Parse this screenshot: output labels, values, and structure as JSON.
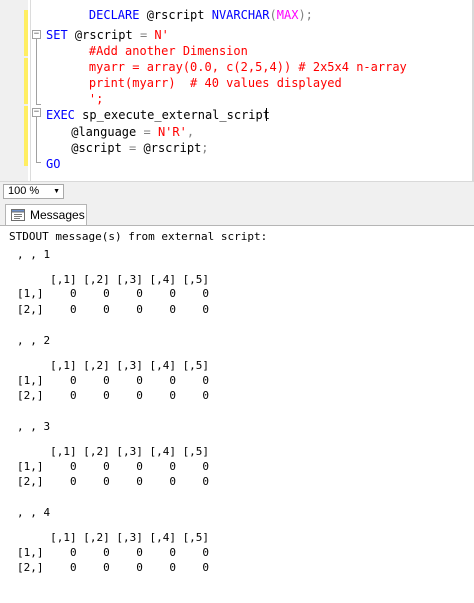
{
  "editor": {
    "lines": [
      [
        {
          "t": "    "
        },
        {
          "t": "DECLARE",
          "c": "kw"
        },
        {
          "t": " @rscript "
        },
        {
          "t": "NVARCHAR",
          "c": "kw"
        },
        {
          "t": "(",
          "c": "op"
        },
        {
          "t": "MAX",
          "c": "fn"
        },
        {
          "t": ");",
          "c": "op"
        }
      ],
      [
        {
          "t": "SET",
          "c": "kw"
        },
        {
          "t": " @rscript "
        },
        {
          "t": "=",
          "c": "op"
        },
        {
          "t": " "
        },
        {
          "t": "N'",
          "c": "str"
        }
      ],
      [
        {
          "t": "    #Add another Dimension",
          "c": "str"
        }
      ],
      [
        {
          "t": "    myarr = array(0.0, c(2,5,4)) # 2x5x4 n-array",
          "c": "str"
        }
      ],
      [
        {
          "t": "    print(myarr)  # 40 values displayed",
          "c": "str"
        }
      ],
      [
        {
          "t": "    ';",
          "c": "str"
        }
      ],
      [
        {
          "t": "EXEC",
          "c": "kw"
        },
        {
          "t": " sp_execute_external_script"
        }
      ],
      [
        {
          "t": " @language "
        },
        {
          "t": "=",
          "c": "op"
        },
        {
          "t": " "
        },
        {
          "t": "N'R'",
          "c": "str"
        },
        {
          "t": ",",
          "c": "op"
        }
      ],
      [
        {
          "t": " @script "
        },
        {
          "t": "=",
          "c": "op"
        },
        {
          "t": " @rscript"
        },
        {
          "t": ";",
          "c": "op"
        }
      ],
      [
        {
          "t": "GO",
          "c": "kw"
        }
      ]
    ]
  },
  "zoom": {
    "value": "100 %"
  },
  "results_tab": {
    "label": "Messages",
    "icon": "messages-icon"
  },
  "output": {
    "header": "STDOUT message(s) from external script:",
    "slices": [
      {
        "label": ", , 1",
        "header": "     [,1] [,2] [,3] [,4] [,5]",
        "rows": [
          "[1,]    0    0    0    0    0",
          "[2,]    0    0    0    0    0"
        ]
      },
      {
        "label": ", , 2",
        "header": "     [,1] [,2] [,3] [,4] [,5]",
        "rows": [
          "[1,]    0    0    0    0    0",
          "[2,]    0    0    0    0    0"
        ]
      },
      {
        "label": ", , 3",
        "header": "     [,1] [,2] [,3] [,4] [,5]",
        "rows": [
          "[1,]    0    0    0    0    0",
          "[2,]    0    0    0    0    0"
        ]
      },
      {
        "label": ", , 4",
        "header": "     [,1] [,2] [,3] [,4] [,5]",
        "rows": [
          "[1,]    0    0    0    0    0",
          "[2,]    0    0    0    0    0"
        ]
      }
    ]
  },
  "colors": {
    "keyword": "#0000ff",
    "function": "#ff00ff",
    "string": "#ff0000",
    "operator": "#808080",
    "change_bar": "#ffee62"
  }
}
